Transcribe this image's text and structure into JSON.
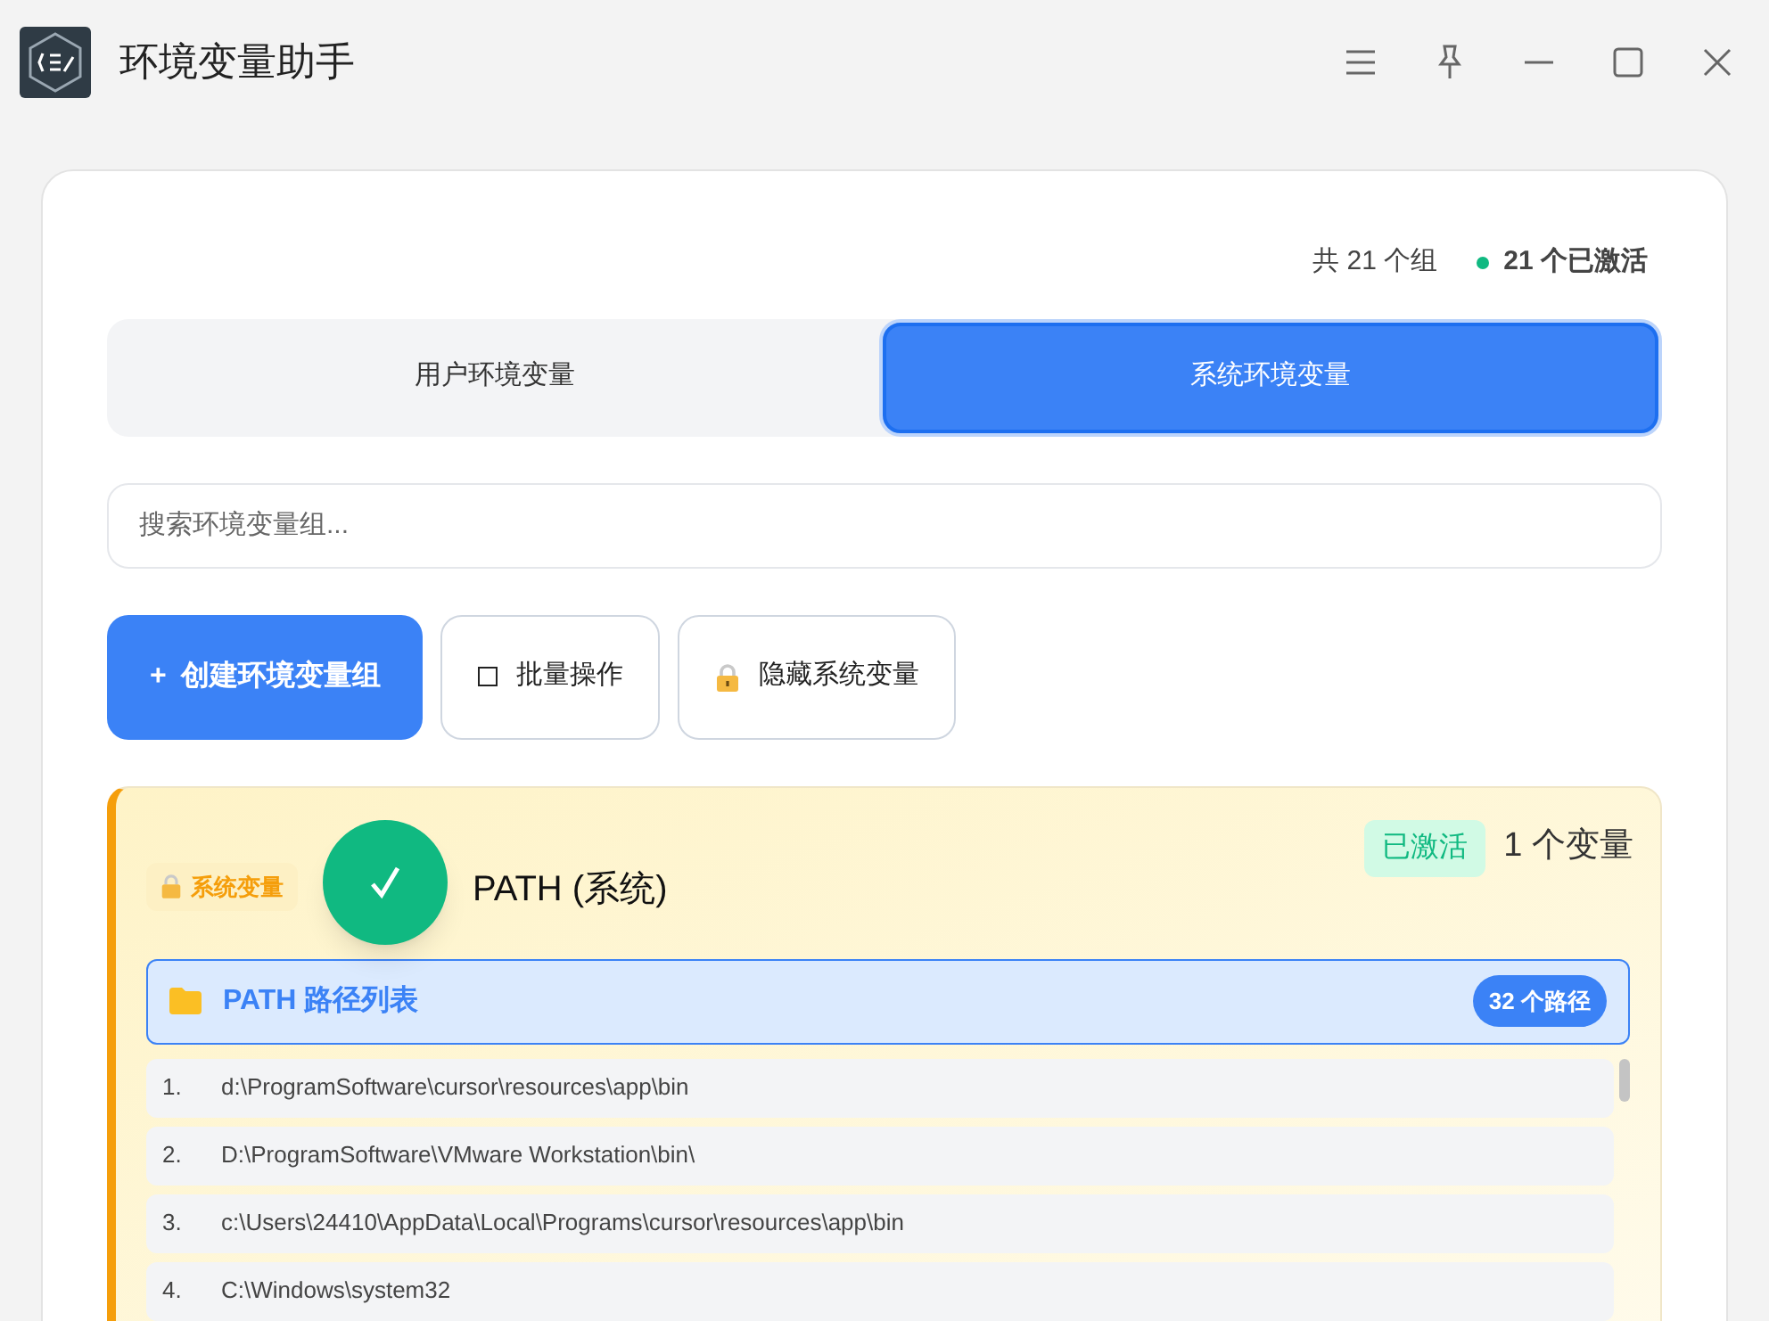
{
  "window": {
    "title": "环境变量助手"
  },
  "stats": {
    "total": "共 21 个组",
    "active": "21 个已激活"
  },
  "tabs": [
    {
      "label": "用户环境变量",
      "selected": false
    },
    {
      "label": "系统环境变量",
      "selected": true
    }
  ],
  "search": {
    "placeholder": "搜索环境变量组..."
  },
  "actions": [
    {
      "kind": "primary",
      "icon": "+",
      "label": "创建环境变量组"
    },
    {
      "kind": "checkbox",
      "label": "批量操作"
    },
    {
      "kind": "lock",
      "label": "隐藏系统变量"
    }
  ],
  "group": {
    "badge": "系统变量",
    "active": true,
    "name": "PATH (系统)",
    "status": "已激活",
    "count": "1 个变量",
    "path_list": {
      "title": "PATH 路径列表",
      "count": "32 个路径",
      "rows": [
        {
          "index": "1.",
          "path": "d:\\ProgramSoftware\\cursor\\resources\\app\\bin"
        },
        {
          "index": "2.",
          "path": "D:\\ProgramSoftware\\VMware Workstation\\bin\\"
        },
        {
          "index": "3.",
          "path": "c:\\Users\\24410\\AppData\\Local\\Programs\\cursor\\resources\\app\\bin"
        },
        {
          "index": "4.",
          "path": "C:\\Windows\\system32"
        }
      ]
    }
  }
}
